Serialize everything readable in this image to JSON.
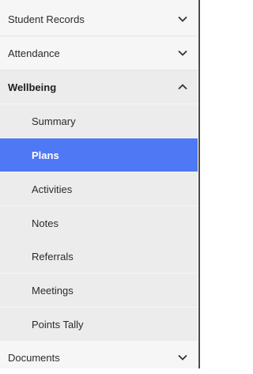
{
  "nav": {
    "student_records": "Student Records",
    "attendance": "Attendance",
    "wellbeing": "Wellbeing",
    "documents": "Documents",
    "wellbeing_items": [
      "Summary",
      "Plans",
      "Activities",
      "Notes",
      "Referrals",
      "Meetings",
      "Points Tally"
    ],
    "active_item": "Plans"
  },
  "colors": {
    "active_bg": "#4f78f5",
    "sidebar_bg": "#f6f6f6",
    "submenu_bg": "#ececec"
  },
  "icons": {
    "collapsed": "chevron-down-icon",
    "expanded": "chevron-up-icon"
  }
}
